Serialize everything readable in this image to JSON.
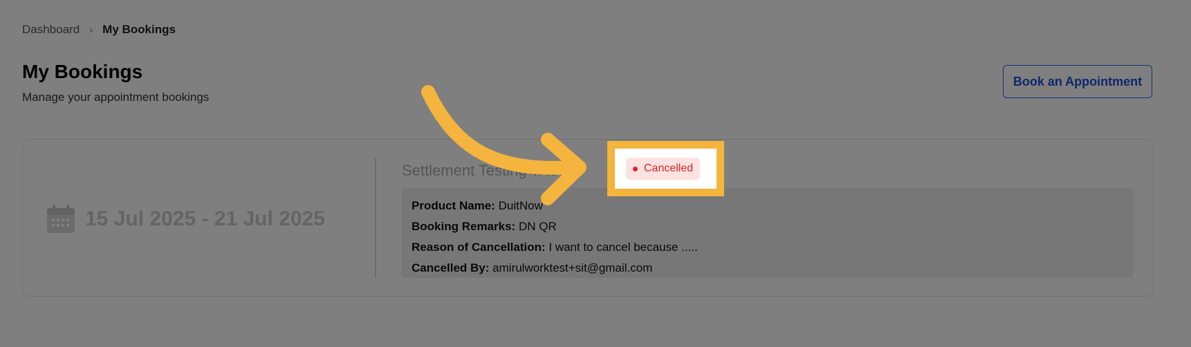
{
  "breadcrumb": {
    "items": [
      "Dashboard",
      "My Bookings"
    ],
    "separator": "›"
  },
  "header": {
    "title": "My Bookings",
    "subtitle": "Manage your appointment bookings",
    "book_button": "Book an Appointment"
  },
  "booking": {
    "date_range": "15 Jul 2025 - 21 Jul 2025",
    "service": "Settlement Testing TAS",
    "status": "Cancelled",
    "details": [
      {
        "label": "Product Name:",
        "value": "DuitNow"
      },
      {
        "label": "Booking Remarks:",
        "value": "DN QR"
      },
      {
        "label": "Reason of Cancellation:",
        "value": "I want to cancel because ....."
      },
      {
        "label": "Cancelled By:",
        "value": "amirulworktest+sit@gmail.com"
      }
    ]
  },
  "icons": {
    "calendar": "calendar-icon",
    "arrow": "arrow-annotation-icon"
  },
  "colors": {
    "accent_blue": "#1d4ed8",
    "status_red": "#dc2626",
    "status_bg": "#fde2e2",
    "highlight": "#f4b43d",
    "overlay": "rgba(0,0,0,0.5)"
  }
}
